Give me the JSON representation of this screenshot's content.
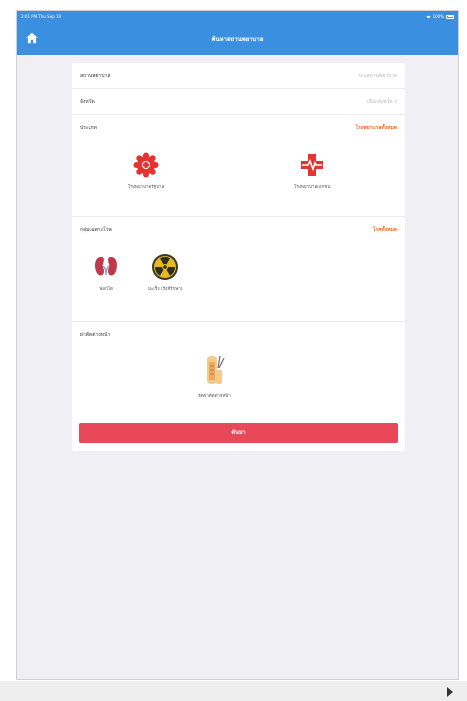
{
  "status_bar": {
    "time": "2:01 PM  Thu Sep 19",
    "battery": "100%"
  },
  "navbar": {
    "title": "ค้นหาสถานพยาบาล"
  },
  "form": {
    "hospital_label": "สถานพยาบาล",
    "hospital_placeholder": "ระบุสถานพยาบาล",
    "province_label": "จังหวัด",
    "province_value": "เลือกจังหวัด"
  },
  "type_section": {
    "label": "ประเภท",
    "link": "โรงพยาบาลทั้งหมด",
    "options": [
      {
        "label": "โรงพยาบาลรัฐบาล",
        "icon": "government-hospital-icon"
      },
      {
        "label": "โรงพยาบาลเอกชน",
        "icon": "private-hospital-icon"
      }
    ]
  },
  "disease_section": {
    "label": "กลุ่มเฉพาะโรค",
    "link": "โรคทั้งหมด",
    "options": [
      {
        "label": "ฟอกไต",
        "icon": "kidney-icon"
      },
      {
        "label": "มะเร็ง (รังสีรักษา)",
        "icon": "radiation-icon"
      }
    ]
  },
  "delivery_section": {
    "label": "ผ่าตัดต่างหน้า",
    "options": [
      {
        "label": "จัดผ่าตัดต่างหน้า",
        "icon": "surgery-icon"
      }
    ]
  },
  "search_button": {
    "label": "ค้นหา"
  },
  "colors": {
    "primary": "#3b8fe0",
    "accent": "#f36a23",
    "button": "#e84858",
    "icon_red": "#e3342f"
  }
}
